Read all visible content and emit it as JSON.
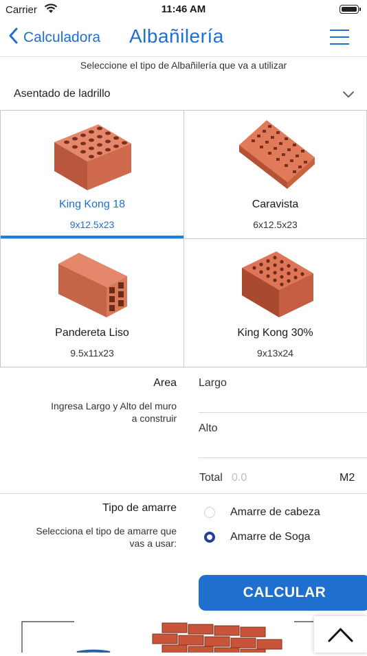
{
  "status": {
    "carrier": "Carrier",
    "time": "11:46 AM"
  },
  "nav": {
    "back_label": "Calculadora",
    "title": "Albañilería"
  },
  "subtitle": "Seleccione el tipo de Albañilería que va a utilizar",
  "dropdown": {
    "selected": "Asentado de ladrillo"
  },
  "bricks": [
    {
      "name": "King Kong 18",
      "dims": "9x12.5x23",
      "selected": true
    },
    {
      "name": "Caravista",
      "dims": "6x12.5x23",
      "selected": false
    },
    {
      "name": "Pandereta Liso",
      "dims": "9.5x11x23",
      "selected": false
    },
    {
      "name": "King Kong 30%",
      "dims": "9x13x24",
      "selected": false
    }
  ],
  "area": {
    "heading": "Area",
    "hint_line1": "Ingresa Largo y Alto del muro",
    "hint_line2": "a construir",
    "largo_placeholder": "Largo",
    "alto_placeholder": "Alto",
    "total_label": "Total",
    "total_value": "0.0",
    "unit": "M2"
  },
  "amarre": {
    "heading": "Tipo de amarre",
    "hint_line1": "Selecciona el tipo de amarre que",
    "hint_line2": "vas a usar:",
    "options": [
      {
        "label": "Amarre de cabeza",
        "checked": false
      },
      {
        "label": "Amarre de Soga",
        "checked": true
      }
    ]
  },
  "calcular_label": "CALCULAR",
  "colors": {
    "accent": "#1f6fcf",
    "brick": "#d9704f",
    "radio_on": "#1f3f9e"
  },
  "icons": [
    "wifi-icon",
    "battery-icon",
    "chevron-left-icon",
    "hamburger-menu-icon",
    "chevron-down-icon",
    "chevron-up-icon"
  ]
}
